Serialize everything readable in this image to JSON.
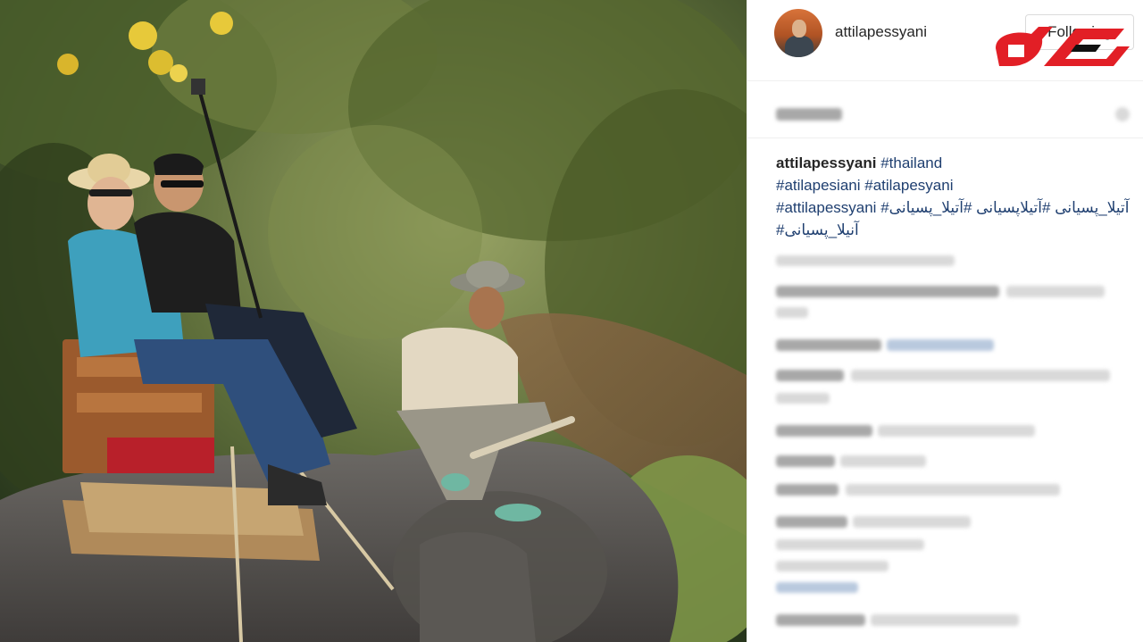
{
  "post": {
    "username": "attilapessyani",
    "follow_label": "Following",
    "photo_alt": "Three men riding an elephant on a forest path in Thailand",
    "brand_logo_colors": {
      "fill": "#e21f26",
      "mark": "#111111"
    }
  },
  "caption": {
    "author": "attilapessyani",
    "lines": [
      [
        "#thailand"
      ],
      [
        "#atilapesiani",
        "#atilapesyani"
      ],
      [
        "#attilapessyani",
        "#آتیلا_پسیانی",
        "#آتیلاپسیانی",
        "#آتیلا_پسیانی"
      ],
      [
        "#آنیلا_پسیانی"
      ]
    ]
  },
  "colors": {
    "text": "#262626",
    "hashtag": "#1f3f70",
    "border": "#dbdbdb"
  }
}
